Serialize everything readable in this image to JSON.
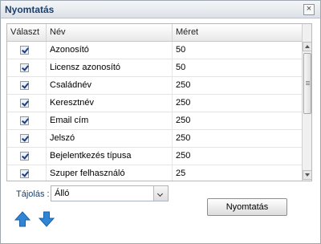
{
  "window": {
    "title": "Nyomtatás",
    "close_label": "×"
  },
  "grid": {
    "columns": [
      "Választ",
      "Név",
      "Méret"
    ],
    "rows": [
      {
        "checked": true,
        "name": "Azonosító",
        "size": "50"
      },
      {
        "checked": true,
        "name": "Licensz azonosító",
        "size": "50"
      },
      {
        "checked": true,
        "name": "Családnév",
        "size": "250"
      },
      {
        "checked": true,
        "name": "Keresztnév",
        "size": "250"
      },
      {
        "checked": true,
        "name": "Email cím",
        "size": "250"
      },
      {
        "checked": true,
        "name": "Jelszó",
        "size": "250"
      },
      {
        "checked": true,
        "name": "Bejelentkezés típusa",
        "size": "250"
      },
      {
        "checked": true,
        "name": "Szuper felhasználó",
        "size": "25"
      }
    ]
  },
  "orientation": {
    "label": "Tájolás :",
    "value": "Álló"
  },
  "buttons": {
    "print_label": "Nyomtatás"
  },
  "colors": {
    "arrow_blue": "#2f86d6",
    "title_text": "#1c3f6b"
  },
  "icons": {
    "move_up": "arrow-up-icon",
    "move_down": "arrow-down-icon"
  }
}
